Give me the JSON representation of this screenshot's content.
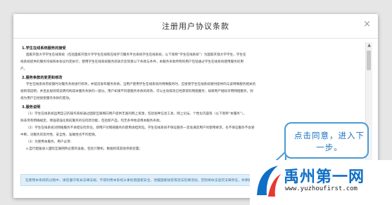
{
  "modal": {
    "title": "注册用户协议条款",
    "close": "×",
    "sections": [
      {
        "title": "1.学生在线系统服务的接受",
        "paragraphs": [
          "国家开放大学学生在线系统（包括国家开放大学学生在线和在线学习服务平台系统学生在线系统，以下简称“学生在线系统”）为国家开放大学学生，学生在",
          "线系统提供的服务均按照本协议约定执行，使用学生在线系统服务即表示您同意以下条款与条件，本服务条款所称的用户包括通过学生在线系统使用服务的用",
          "户。"
        ]
      },
      {
        "title": "2.服务条款的变更和修改",
        "paragraphs": [
          "学生在线系统有权随时对服务条款进行修改，并提前发布服务条款。当用户使用学生在线系统的特殊服务时，应接受学生在线系统随时提供的与该特殊服务相关的",
          "规则或说明，并且此规则或说明均构成本服务条款的一部分。用户如果不同意服务条款的修改，可以主动取消已经获得的网络服务；如果用户继续享用网络服务，则",
          "视为用户已经接受服务条款的变动。"
        ]
      },
      {
        "title": "3.服务说明",
        "paragraphs": [
          "（1）学生在线系统运用自己的操作系统通过国际互联网向用户提供丰富的网上资源，包括各种信息工具、网上论坛、个性化内容等（以下简称“本服务”），",
          "除非另有明确规定，增强或强化目前服务的任何新功能，包括新产品，均无条件地适用本服务条款。",
          "（2）学生在线系统对网络服务不承担任何责任，即用户对网络服务的使用承担风险。学生在线系统不保证服务一定会满足用户的使用要求，也不保证服务不会受",
          "中断，对服务的及时性、安全性、准确性也不作担保。",
          "（3）为使用本服务，用户必须：",
          "a.自行配备进入国际互联网所必需的设备，包括计算机、数据机或其他存取装置；"
        ]
      }
    ],
    "notice": "在使用本系统的过程中，请您遵守有关法律法规，不得利用本系统从事危害国家安全、泄露国家秘密等违法犯罪活动，否则将依法追究法律责任，并承担相应后果。"
  },
  "callout": {
    "text": "点击同意，进入下一步。"
  },
  "watermark": {
    "title": "禹州第一网",
    "url": "www.yuzhoufirst.com"
  }
}
